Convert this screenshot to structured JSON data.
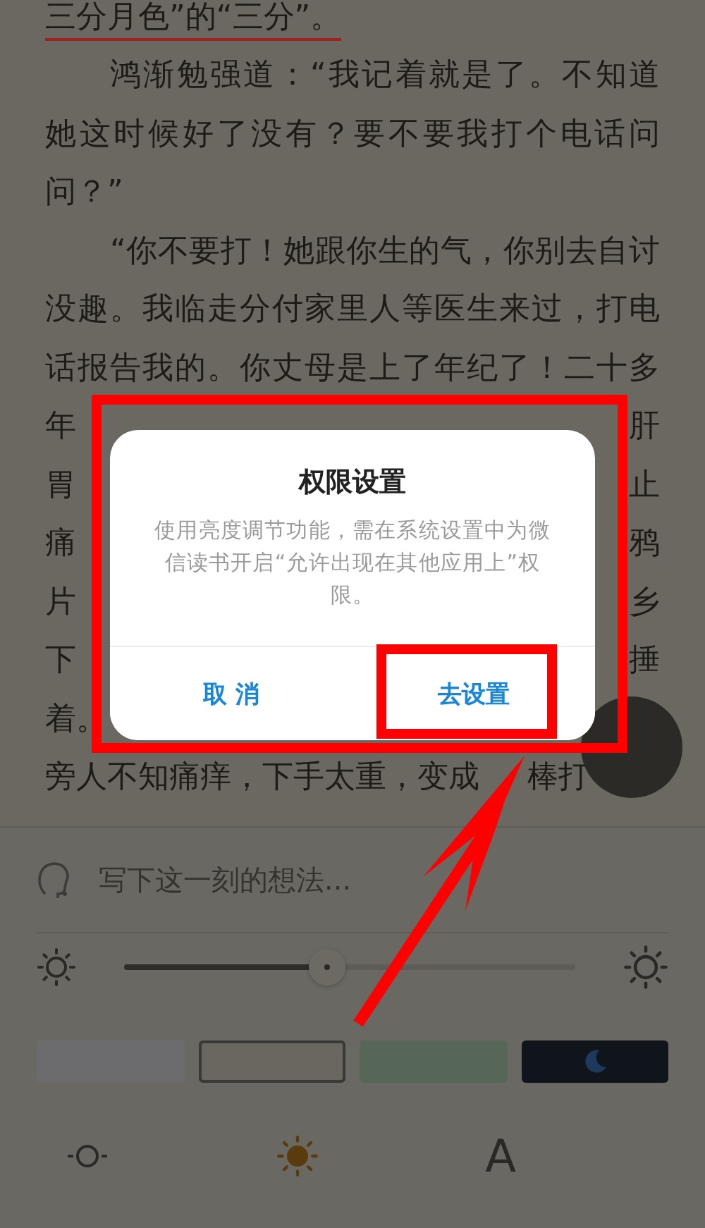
{
  "reader": {
    "lines": [
      {
        "kind": "end",
        "text": "三分月色”的“三分”。",
        "underlined": true
      },
      {
        "kind": "start",
        "text": "鸿渐勉强道：“我记着就是了。不知道",
        "underlined": false
      },
      {
        "kind": "line",
        "text": "她这时候好了没有？要不要我打个电话问",
        "underlined": false
      },
      {
        "kind": "end",
        "text": "问？”",
        "underlined": false
      },
      {
        "kind": "start",
        "text": "“你不要打！她跟你生的气，你别去自讨",
        "underlined": false
      },
      {
        "kind": "line",
        "text": "没趣。我临走分付家里人等医生来过，打电",
        "underlined": false
      },
      {
        "kind": "line",
        "text": "话报告我的。你丈母是上了年纪了！二十多",
        "underlined": false
      },
      {
        "kind": "split",
        "left": "年",
        "right": "肝",
        "underlined": false
      },
      {
        "kind": "split",
        "left": "胃",
        "right": "止",
        "underlined": false
      },
      {
        "kind": "split",
        "left": "痛",
        "right": "鸦",
        "underlined": false
      },
      {
        "kind": "split",
        "left": "片",
        "right": "乡",
        "underlined": false
      },
      {
        "kind": "split",
        "left": "下",
        "right": "捶",
        "underlined": false
      },
      {
        "kind": "split",
        "left": "着。",
        "underlined": false
      },
      {
        "kind": "gapped",
        "left": "旁人不知痛痒，下手太重，变成",
        "right": "棒打",
        "underlined": false
      }
    ]
  },
  "dialog": {
    "title": "权限设置",
    "message": "使用亮度调节功能，需在系统设置中为微信读书开启“允许出现在其他应用上”权限。",
    "buttons": [
      {
        "label": "取 消"
      },
      {
        "label": "去设置"
      }
    ]
  },
  "panel": {
    "note": {
      "placeholder": "写下这一刻的想法..."
    },
    "brightness": {
      "level": 0.45
    },
    "themes": [
      {
        "kind": "plain",
        "color": "#6c6c6e",
        "selected": false
      },
      {
        "kind": "plain",
        "color": "#6a6660",
        "selected": true
      },
      {
        "kind": "plain",
        "color": "#566657",
        "selected": false
      },
      {
        "kind": "night",
        "color": "#10141b",
        "selected": false
      }
    ],
    "toolbar": [
      {
        "kind": "brightness"
      },
      {
        "kind": "sun"
      },
      {
        "kind": "font",
        "label": "A"
      }
    ]
  },
  "annotations": [
    {
      "kind": "frame"
    },
    {
      "kind": "frame"
    },
    {
      "kind": "arrow"
    }
  ]
}
